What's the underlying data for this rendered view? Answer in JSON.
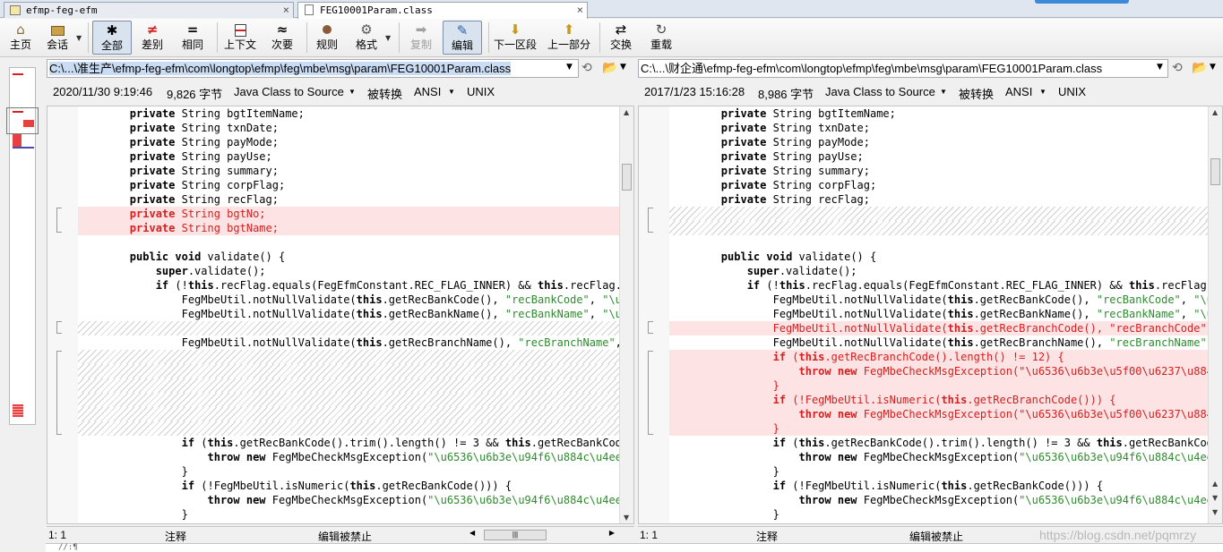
{
  "tabs": [
    {
      "label": "efmp-feg-efm",
      "close": "×"
    },
    {
      "label": "FEG10001Param.class",
      "close": "×"
    }
  ],
  "toolbar": {
    "home": {
      "label": "主页",
      "icon": "home-icon"
    },
    "session": {
      "label": "会话",
      "icon": "briefcase-icon"
    },
    "all": {
      "label": "全部",
      "icon": "asterisk-icon",
      "glyph": "✱"
    },
    "diff": {
      "label": "差别",
      "icon": "not-equal-icon",
      "glyph": "≠"
    },
    "same": {
      "label": "相同",
      "icon": "equal-icon",
      "glyph": "="
    },
    "context": {
      "label": "上下文",
      "icon": "context-icon"
    },
    "minor": {
      "label": "次要",
      "icon": "approx-icon",
      "glyph": "≈"
    },
    "rules": {
      "label": "规则",
      "icon": "rules-icon"
    },
    "format": {
      "label": "格式",
      "icon": "format-icon"
    },
    "copy": {
      "label": "复制",
      "icon": "copy-arrow-icon"
    },
    "edit": {
      "label": "编辑",
      "icon": "pencil-icon"
    },
    "next_section": {
      "label": "下一区段",
      "icon": "down-arrow-icon"
    },
    "prev_part": {
      "label": "上一部分",
      "icon": "up-arrow-icon"
    },
    "swap": {
      "label": "交换",
      "icon": "swap-icon"
    },
    "reload": {
      "label": "重载",
      "icon": "reload-icon"
    }
  },
  "left": {
    "path": "C:\\...\\准生产\\efmp-feg-efm\\com\\longtop\\efmp\\feg\\mbe\\msg\\param\\FEG10001Param.class",
    "date": "2020/11/30 9:19:46",
    "size": "9,826 字节",
    "format": "Java Class to Source",
    "converted": "被转换",
    "encoding": "ANSI",
    "eol": "UNIX",
    "status_pos": "1: 1",
    "status_mode": "注释",
    "status_edit": "编辑被禁止",
    "lines": [
      {
        "t": "        private String bgtItemName;",
        "k": "private"
      },
      {
        "t": "        private String txnDate;",
        "k": "private"
      },
      {
        "t": "        private String payMode;",
        "k": "private"
      },
      {
        "t": "        private String payUse;",
        "k": "private"
      },
      {
        "t": "        private String summary;",
        "k": "private"
      },
      {
        "t": "        private String corpFlag;",
        "k": "private"
      },
      {
        "t": "        private String recFlag;",
        "k": "private"
      },
      {
        "t": "        private String bgtNo;",
        "k": "private",
        "del": true
      },
      {
        "t": "        private String bgtName;",
        "k": "private",
        "del": true
      },
      {
        "t": ""
      },
      {
        "t": "        public void validate() {",
        "k": "public void"
      },
      {
        "t": "            super.validate();",
        "k": "super"
      },
      {
        "t": "            if (!this.recFlag.equals(FegEfmConstant.REC_FLAG_INNER) && this.recFlag.equals",
        "k": "if this this"
      },
      {
        "t": "                FegMbeUtil.notNullValidate(this.getRecBankCode(), \"recBankCode\", \"\\u6536\\u",
        "k": "this"
      },
      {
        "t": "                FegMbeUtil.notNullValidate(this.getRecBankName(), \"recBankName\", \"\\u6536\\u",
        "k": "this"
      },
      {
        "t": "",
        "hatch": true
      },
      {
        "t": "                FegMbeUtil.notNullValidate(this.getRecBranchName(), \"recBranchName\", \"\\u65",
        "k": "this"
      },
      {
        "t": "",
        "hatch": true
      },
      {
        "t": "",
        "hatch": true
      },
      {
        "t": "",
        "hatch": true
      },
      {
        "t": "",
        "hatch": true
      },
      {
        "t": "",
        "hatch": true
      },
      {
        "t": "",
        "hatch": true
      },
      {
        "t": "                if (this.getRecBankCode().trim().length() != 3 && this.getRecBankCode().tr",
        "k": "if this this"
      },
      {
        "t": "                    throw new FegMbeCheckMsgException(\"\\u6536\\u6b3e\\u94f6\\u884c\\u4ee3\\u780",
        "k": "throw new"
      },
      {
        "t": "                }"
      },
      {
        "t": "                if (!FegMbeUtil.isNumeric(this.getRecBankCode())) {",
        "k": "if this"
      },
      {
        "t": "                    throw new FegMbeCheckMsgException(\"\\u6536\\u6b3e\\u94f6\\u884c\\u4ee3\\u780",
        "k": "throw new"
      },
      {
        "t": "                }"
      }
    ]
  },
  "right": {
    "path": "C:\\...\\财企通\\efmp-feg-efm\\com\\longtop\\efmp\\feg\\mbe\\msg\\param\\FEG10001Param.class",
    "date": "2017/1/23 15:16:28",
    "size": "8,986 字节",
    "format": "Java Class to Source",
    "converted": "被转换",
    "encoding": "ANSI",
    "eol": "UNIX",
    "status_pos": "1: 1",
    "status_mode": "注释",
    "status_edit": "编辑被禁止",
    "lines": [
      {
        "t": "        private String bgtItemName;",
        "k": "private"
      },
      {
        "t": "        private String txnDate;",
        "k": "private"
      },
      {
        "t": "        private String payMode;",
        "k": "private"
      },
      {
        "t": "        private String payUse;",
        "k": "private"
      },
      {
        "t": "        private String summary;",
        "k": "private"
      },
      {
        "t": "        private String corpFlag;",
        "k": "private"
      },
      {
        "t": "        private String recFlag;",
        "k": "private"
      },
      {
        "t": "",
        "hatch": true
      },
      {
        "t": "",
        "hatch": true
      },
      {
        "t": ""
      },
      {
        "t": "        public void validate() {",
        "k": "public void"
      },
      {
        "t": "            super.validate();",
        "k": "super"
      },
      {
        "t": "            if (!this.recFlag.equals(FegEfmConstant.REC_FLAG_INNER) && this.recFlag.equals",
        "k": "if this this"
      },
      {
        "t": "                FegMbeUtil.notNullValidate(this.getRecBankCode(), \"recBankCode\", \"\\u6536\\u",
        "k": "this"
      },
      {
        "t": "                FegMbeUtil.notNullValidate(this.getRecBankName(), \"recBankName\", \"\\u6536\\u",
        "k": "this"
      },
      {
        "t": "                FegMbeUtil.notNullValidate(this.getRecBranchCode(), \"recBranchCode\", \"\\u65",
        "k": "this",
        "del": true
      },
      {
        "t": "                FegMbeUtil.notNullValidate(this.getRecBranchName(), \"recBranchName\", \"\\u65",
        "k": "this"
      },
      {
        "t": "                if (this.getRecBranchCode().length() != 12) {",
        "k": "if this",
        "del": true
      },
      {
        "t": "                    throw new FegMbeCheckMsgException(\"\\u6536\\u6b3e\\u5f00\\u6237\\u884c\\u53f",
        "k": "throw new",
        "del": true
      },
      {
        "t": "                }",
        "del": true
      },
      {
        "t": "                if (!FegMbeUtil.isNumeric(this.getRecBranchCode())) {",
        "k": "if this",
        "del": true
      },
      {
        "t": "                    throw new FegMbeCheckMsgException(\"\\u6536\\u6b3e\\u5f00\\u6237\\u884c\\u53f",
        "k": "throw new",
        "del": true
      },
      {
        "t": "                }",
        "del": true
      },
      {
        "t": "                if (this.getRecBankCode().trim().length() != 3 && this.getRecBankCode().tr",
        "k": "if this this"
      },
      {
        "t": "                    throw new FegMbeCheckMsgException(\"\\u6536\\u6b3e\\u94f6\\u884c\\u4ee3\\u780",
        "k": "throw new"
      },
      {
        "t": "                }"
      },
      {
        "t": "                if (!FegMbeUtil.isNumeric(this.getRecBankCode())) {",
        "k": "if this"
      },
      {
        "t": "                    throw new FegMbeCheckMsgException(\"\\u6536\\u6b3e\\u94f6\\u884c\\u4ee3\\u780",
        "k": "throw new"
      },
      {
        "t": "                }"
      }
    ]
  },
  "bottom": {
    "text": "//:¶"
  },
  "watermark": "https://blog.csdn.net/pqmrzy",
  "colors": {
    "diff_bg": "#fde3e3",
    "diff_text": "#d42020",
    "string": "#2e8b2e",
    "accent": "#3a8ad9"
  }
}
